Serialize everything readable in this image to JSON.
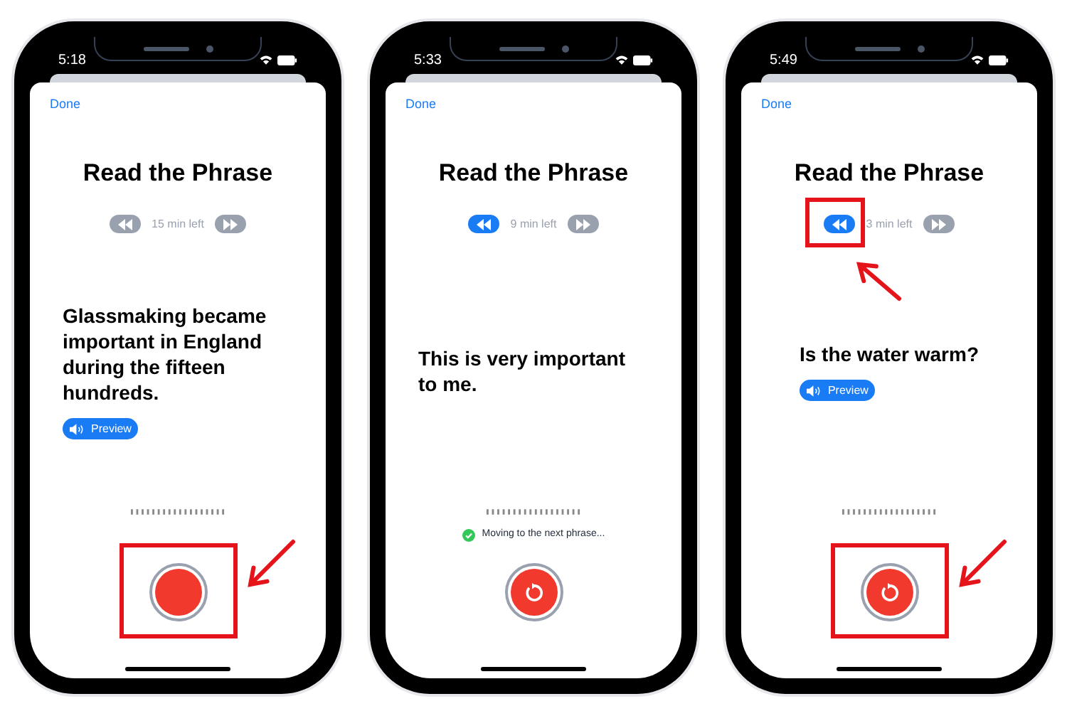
{
  "phones": [
    {
      "time": "5:18",
      "done": "Done",
      "title": "Read the Phrase",
      "back_active": false,
      "time_left": "15 min left",
      "forward_active": false,
      "phrase": "Glassmaking became important in England during the fifteen hundreds.",
      "preview": "Preview",
      "retry": false,
      "record_highlighted": true,
      "back_highlighted": false
    },
    {
      "time": "5:33",
      "done": "Done",
      "title": "Read the Phrase",
      "back_active": true,
      "time_left": "9 min left",
      "forward_active": false,
      "phrase": "This is very important to me.",
      "status": "Moving to the next phrase...",
      "retry": true,
      "record_highlighted": false,
      "back_highlighted": false
    },
    {
      "time": "5:49",
      "done": "Done",
      "title": "Read the Phrase",
      "back_active": true,
      "time_left": "3 min left",
      "forward_active": false,
      "phrase": "Is the water warm?",
      "preview": "Preview",
      "retry": true,
      "record_highlighted": true,
      "back_highlighted": true
    }
  ]
}
